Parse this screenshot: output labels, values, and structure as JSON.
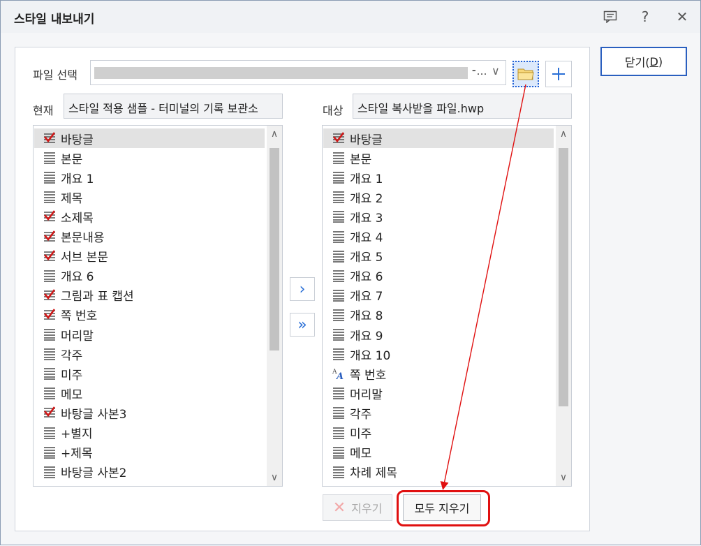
{
  "window": {
    "title": "스타일 내보내기",
    "close_label_prefix": "닫기(",
    "close_label_key": "D",
    "close_label_suffix": ")",
    "help_symbol": "?",
    "close_symbol": "✕"
  },
  "file": {
    "label": "파일 선택",
    "ellipsis": "⁃…",
    "dropdown_symbol": "∨"
  },
  "current": {
    "label": "현재",
    "value": "스타일 적용 샘플 - 터미널의 기록 보관소"
  },
  "target": {
    "label": "대상",
    "value": "스타일 복사받을 파일.hwp"
  },
  "left_list": {
    "items": [
      {
        "label": "바탕글",
        "icon": "check",
        "selected": true
      },
      {
        "label": "본문",
        "icon": "para"
      },
      {
        "label": "개요 1",
        "icon": "para"
      },
      {
        "label": "제목",
        "icon": "para"
      },
      {
        "label": "소제목",
        "icon": "check"
      },
      {
        "label": "본문내용",
        "icon": "check"
      },
      {
        "label": "서브 본문",
        "icon": "check"
      },
      {
        "label": "개요 6",
        "icon": "para"
      },
      {
        "label": "그림과 표 캡션",
        "icon": "check"
      },
      {
        "label": "쪽 번호",
        "icon": "check"
      },
      {
        "label": "머리말",
        "icon": "para"
      },
      {
        "label": "각주",
        "icon": "para"
      },
      {
        "label": "미주",
        "icon": "para"
      },
      {
        "label": "메모",
        "icon": "para"
      },
      {
        "label": "바탕글 사본3",
        "icon": "check"
      },
      {
        "label": "+별지",
        "icon": "para"
      },
      {
        "label": "+제목",
        "icon": "para"
      },
      {
        "label": "바탕글 사본2",
        "icon": "para"
      }
    ]
  },
  "right_list": {
    "items": [
      {
        "label": "바탕글",
        "icon": "check",
        "selected": true
      },
      {
        "label": "본문",
        "icon": "para"
      },
      {
        "label": "개요 1",
        "icon": "para"
      },
      {
        "label": "개요 2",
        "icon": "para"
      },
      {
        "label": "개요 3",
        "icon": "para"
      },
      {
        "label": "개요 4",
        "icon": "para"
      },
      {
        "label": "개요 5",
        "icon": "para"
      },
      {
        "label": "개요 6",
        "icon": "para"
      },
      {
        "label": "개요 7",
        "icon": "para"
      },
      {
        "label": "개요 8",
        "icon": "para"
      },
      {
        "label": "개요 9",
        "icon": "para"
      },
      {
        "label": "개요 10",
        "icon": "para"
      },
      {
        "label": "쪽 번호",
        "icon": "char"
      },
      {
        "label": "머리말",
        "icon": "para"
      },
      {
        "label": "각주",
        "icon": "para"
      },
      {
        "label": "미주",
        "icon": "para"
      },
      {
        "label": "메모",
        "icon": "para"
      },
      {
        "label": "차례 제목",
        "icon": "para"
      }
    ]
  },
  "buttons": {
    "copy_one": "›",
    "copy_all": "»",
    "delete": "지우기",
    "delete_symbol": "✕",
    "clear_all": "모두 지우기",
    "scroll_up": "∧",
    "scroll_down": "∨"
  },
  "colors": {
    "accent": "#2a6fd6",
    "highlight": "#e01010",
    "check": "#d01818"
  }
}
